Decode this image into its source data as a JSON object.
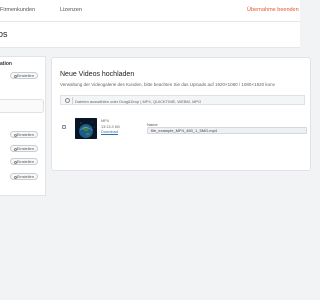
{
  "header": {
    "nav_items": [
      "Firmenkunden",
      "Lizenzen"
    ],
    "accent_link": "Übernahme beenden"
  },
  "page": {
    "title": "os"
  },
  "sidebar": {
    "heading": "ation",
    "install_label": "Einstellen"
  },
  "upload_card": {
    "title": "Neue Videos hochladen",
    "description": "Verwaltung der Videogalerie des Kunden, bitte beachten Sie das Uploads auf 1920×1080 / 1080×1920 konv",
    "dropzone_text": "Dateien auswählen oder Drag&Drop | MP4, QUICKTIME, WEBM, MPG"
  },
  "video_item": {
    "format": "MP4",
    "duration": "13:13.3 KB",
    "download_label": "Download",
    "name_label": "Name",
    "name_value": "file_example_MP4_480_1_5MG.mp4"
  },
  "colors": {
    "accent": "#e4572e",
    "link": "#2a6fb0"
  }
}
